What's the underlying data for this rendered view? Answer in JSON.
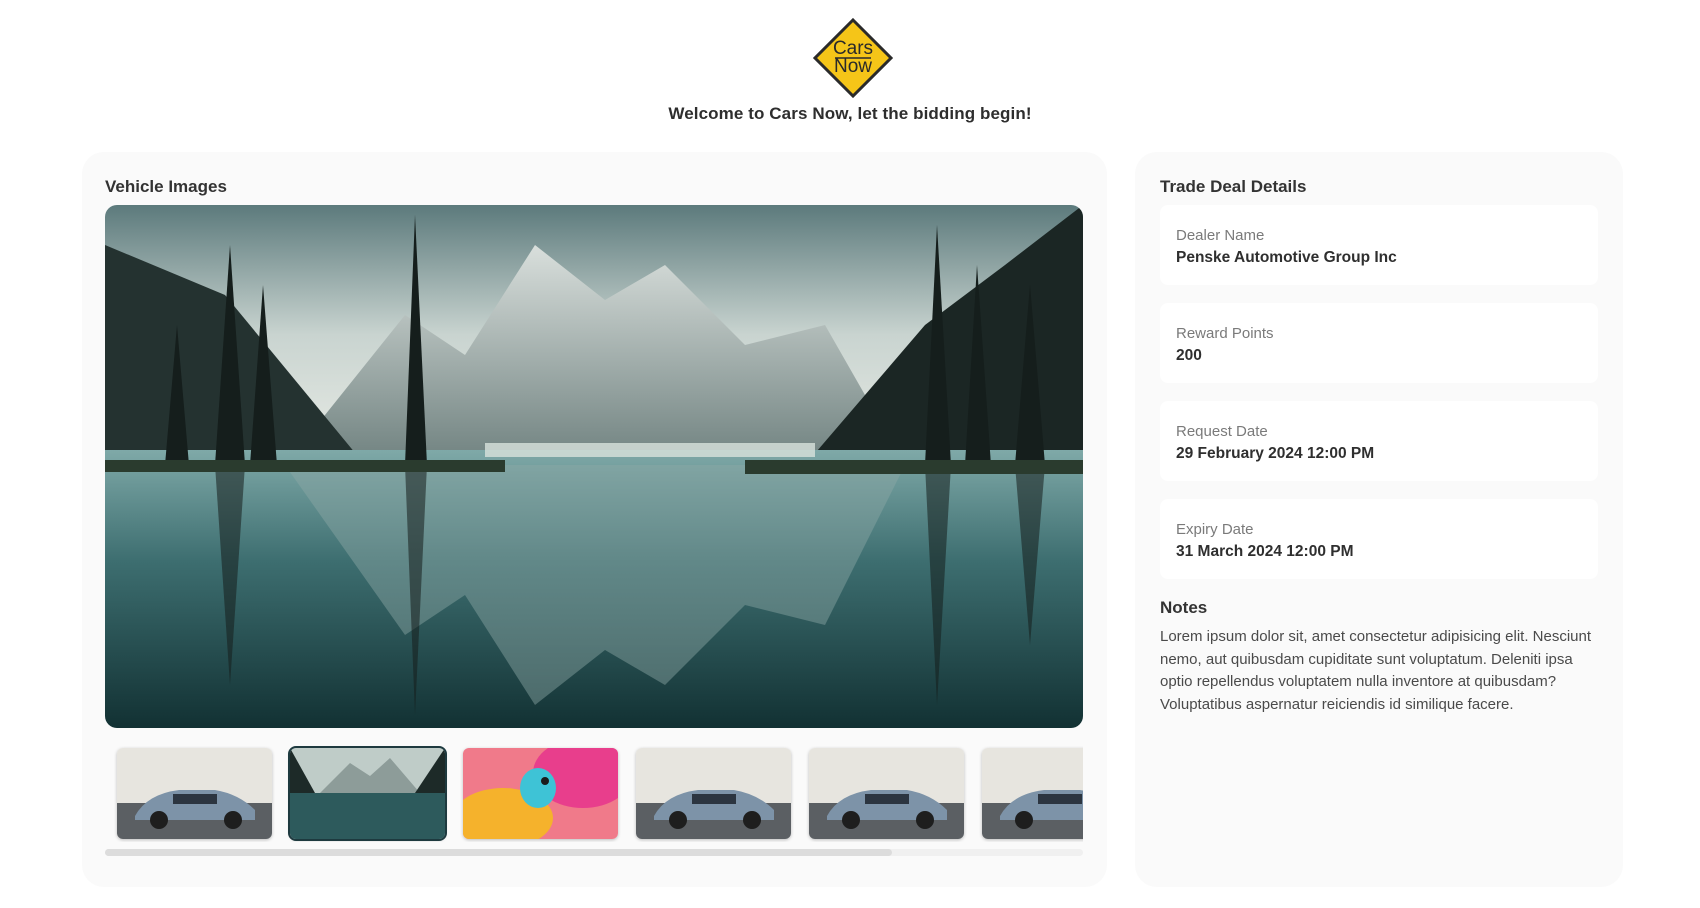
{
  "header": {
    "logo_text_line1": "Cars",
    "logo_text_line2": "Now",
    "welcome": "Welcome to Cars Now, let the bidding begin!"
  },
  "vehicle_images": {
    "title": "Vehicle Images",
    "thumbnails": [
      {
        "kind": "car",
        "selected": false
      },
      {
        "kind": "lake",
        "selected": true
      },
      {
        "kind": "chameleon",
        "selected": false
      },
      {
        "kind": "car",
        "selected": false
      },
      {
        "kind": "car",
        "selected": false
      },
      {
        "kind": "car",
        "selected": false
      }
    ]
  },
  "trade_deal": {
    "title": "Trade Deal Details",
    "fields": [
      {
        "label": "Dealer Name",
        "value": "Penske Automotive Group Inc"
      },
      {
        "label": "Reward Points",
        "value": "200"
      },
      {
        "label": "Request Date",
        "value": "29 February 2024 12:00 PM"
      },
      {
        "label": "Expiry Date",
        "value": "31 March 2024 12:00 PM"
      }
    ],
    "notes_title": "Notes",
    "notes": "Lorem ipsum dolor sit, amet consectetur adipisicing elit. Nesciunt nemo, aut quibusdam cupiditate sunt voluptatum. Deleniti ipsa optio repellendus voluptatem nulla inventore at quibusdam? Voluptatibus aspernatur reiciendis id similique facere."
  },
  "colors": {
    "logo_yellow": "#f5c518",
    "panel_bg": "#fafafa",
    "accent_dark": "#1e3a3f"
  }
}
